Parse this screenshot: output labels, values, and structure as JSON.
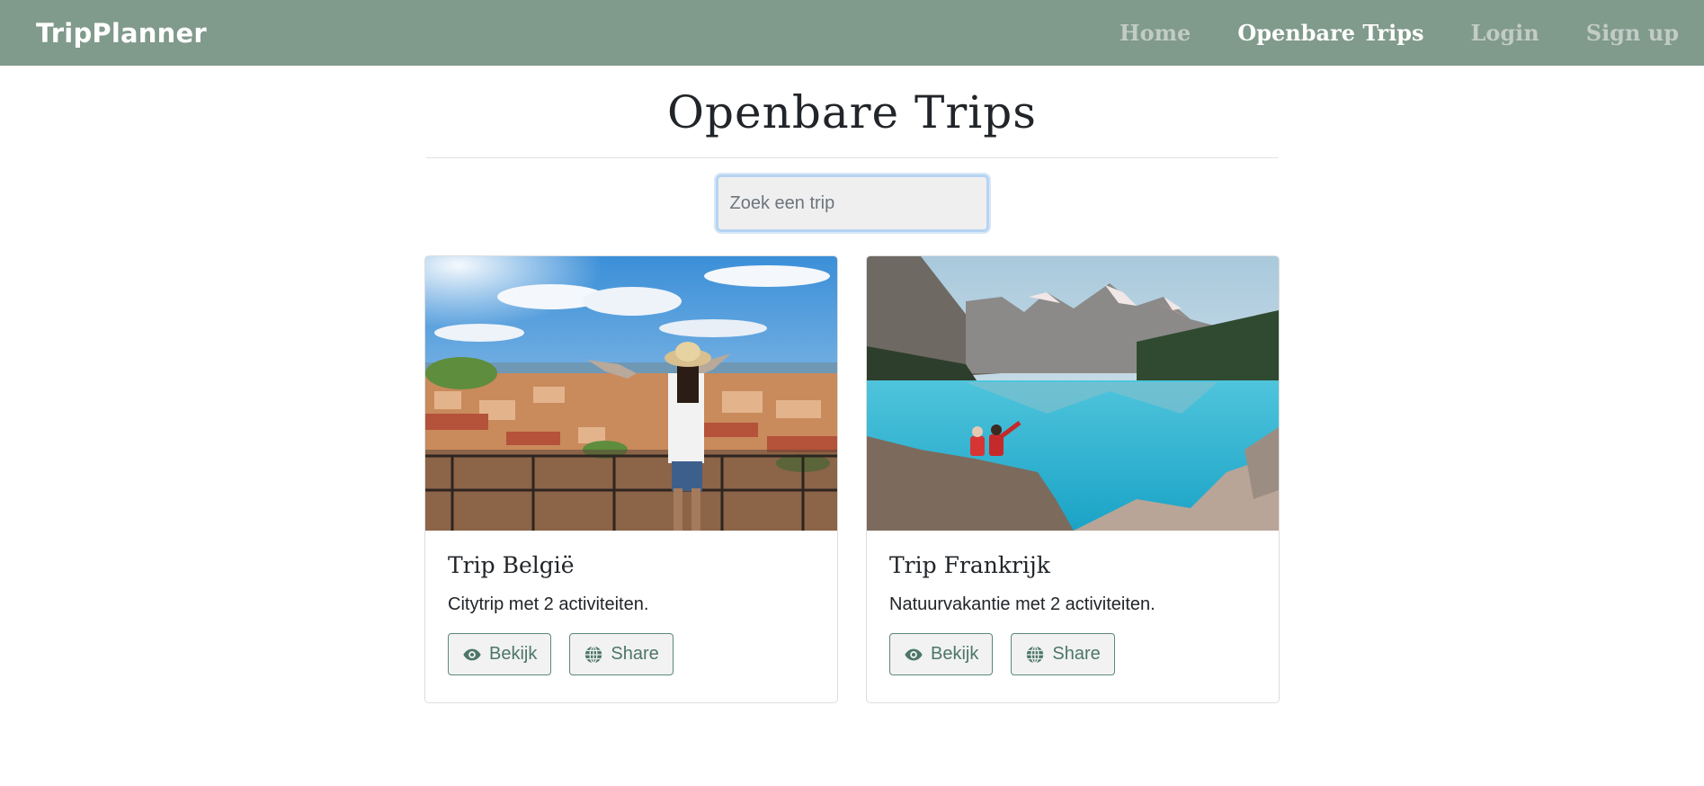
{
  "navbar": {
    "brand": "TripPlanner",
    "links": [
      "Home",
      "Openbare Trips",
      "Login",
      "Sign up"
    ]
  },
  "page": {
    "title": "Openbare Trips"
  },
  "search": {
    "placeholder": "Zoek een trip",
    "value": ""
  },
  "trips": [
    {
      "title": "Trip België",
      "description": "Citytrip met 2 activiteiten.",
      "view_label": "Bekijk",
      "share_label": "Share"
    },
    {
      "title": "Trip Frankrijk",
      "description": "Natuurvakantie met 2 activiteiten.",
      "view_label": "Bekijk",
      "share_label": "Share"
    }
  ],
  "colors": {
    "navbar": "#809a8b",
    "accent": "#4d7669"
  },
  "icons": {
    "view": "eye-icon",
    "share": "globe-icon"
  }
}
